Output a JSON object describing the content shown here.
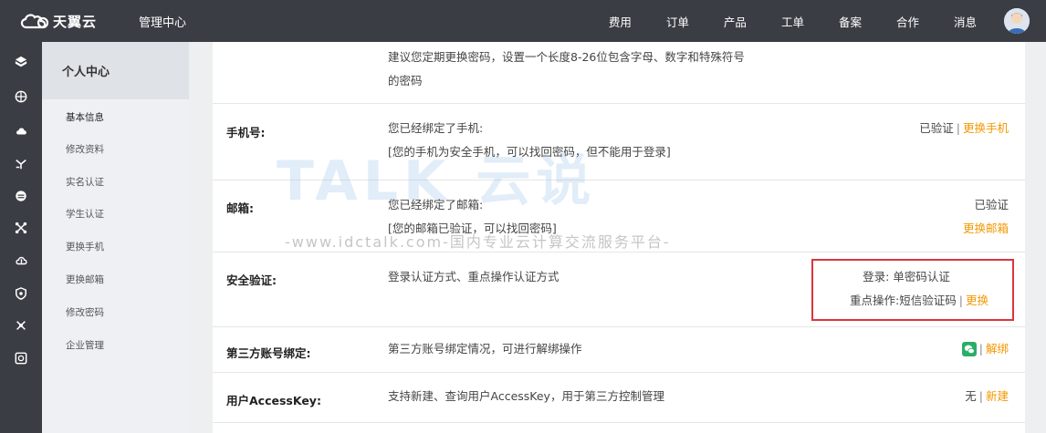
{
  "header": {
    "brand_name": "天翼云",
    "console_title": "管理中心",
    "nav": [
      "费用",
      "订单",
      "产品",
      "工单",
      "备案",
      "合作",
      "消息"
    ]
  },
  "icon_sidebar": [
    "cube-icon",
    "globe-icon",
    "cloud-icon",
    "network-icon",
    "database-icon",
    "link-icon",
    "cloud-storage-icon",
    "shield-icon",
    "tools-icon",
    "monitor-icon"
  ],
  "menu": {
    "title": "个人中心",
    "items": [
      "基本信息",
      "修改资料",
      "实名认证",
      "学生认证",
      "更换手机",
      "更换邮箱",
      "修改密码",
      "企业管理"
    ],
    "active_index": 0
  },
  "rows": {
    "password": {
      "desc_line1": "建议您定期更换密码，设置一个长度8-26位包含字母、数字和特殊符号",
      "desc_line2": "的密码"
    },
    "phone": {
      "label": "手机号:",
      "desc_line1": "您已经绑定了手机:",
      "desc_line2": "[您的手机为安全手机，可以找回密码，但不能用于登录]",
      "status": "已验证",
      "sep": "|",
      "action": "更换手机"
    },
    "email": {
      "label": "邮箱:",
      "desc_line1": "您已经绑定了邮箱:",
      "desc_line2": "[您的邮箱已验证，可以找回密码]",
      "status": "已验证",
      "action": "更换邮箱"
    },
    "security": {
      "label": "安全验证:",
      "desc": "登录认证方式、重点操作认证方式",
      "login_auth": "登录: 单密码认证",
      "key_op_auth": "重点操作:短信验证码",
      "sep": "|",
      "action": "更换"
    },
    "third_party": {
      "label": "第三方账号绑定:",
      "desc": "第三方账号绑定情况，可进行解绑操作",
      "sep": "|",
      "action": "解绑"
    },
    "access_key": {
      "label": "用户AccessKey:",
      "desc": "支持新建、查询用户AccessKey，用于第三方控制管理",
      "status": "无",
      "sep": "|",
      "action": "新建"
    }
  },
  "watermark": {
    "main": "TALK 云说",
    "sub": "-www.idctalk.com-国内专业云计算交流服务平台-"
  },
  "colors": {
    "topbar": "#3a3d44",
    "link": "#f39800",
    "highlight_border": "#d9363e",
    "wechat": "#2aae67"
  }
}
